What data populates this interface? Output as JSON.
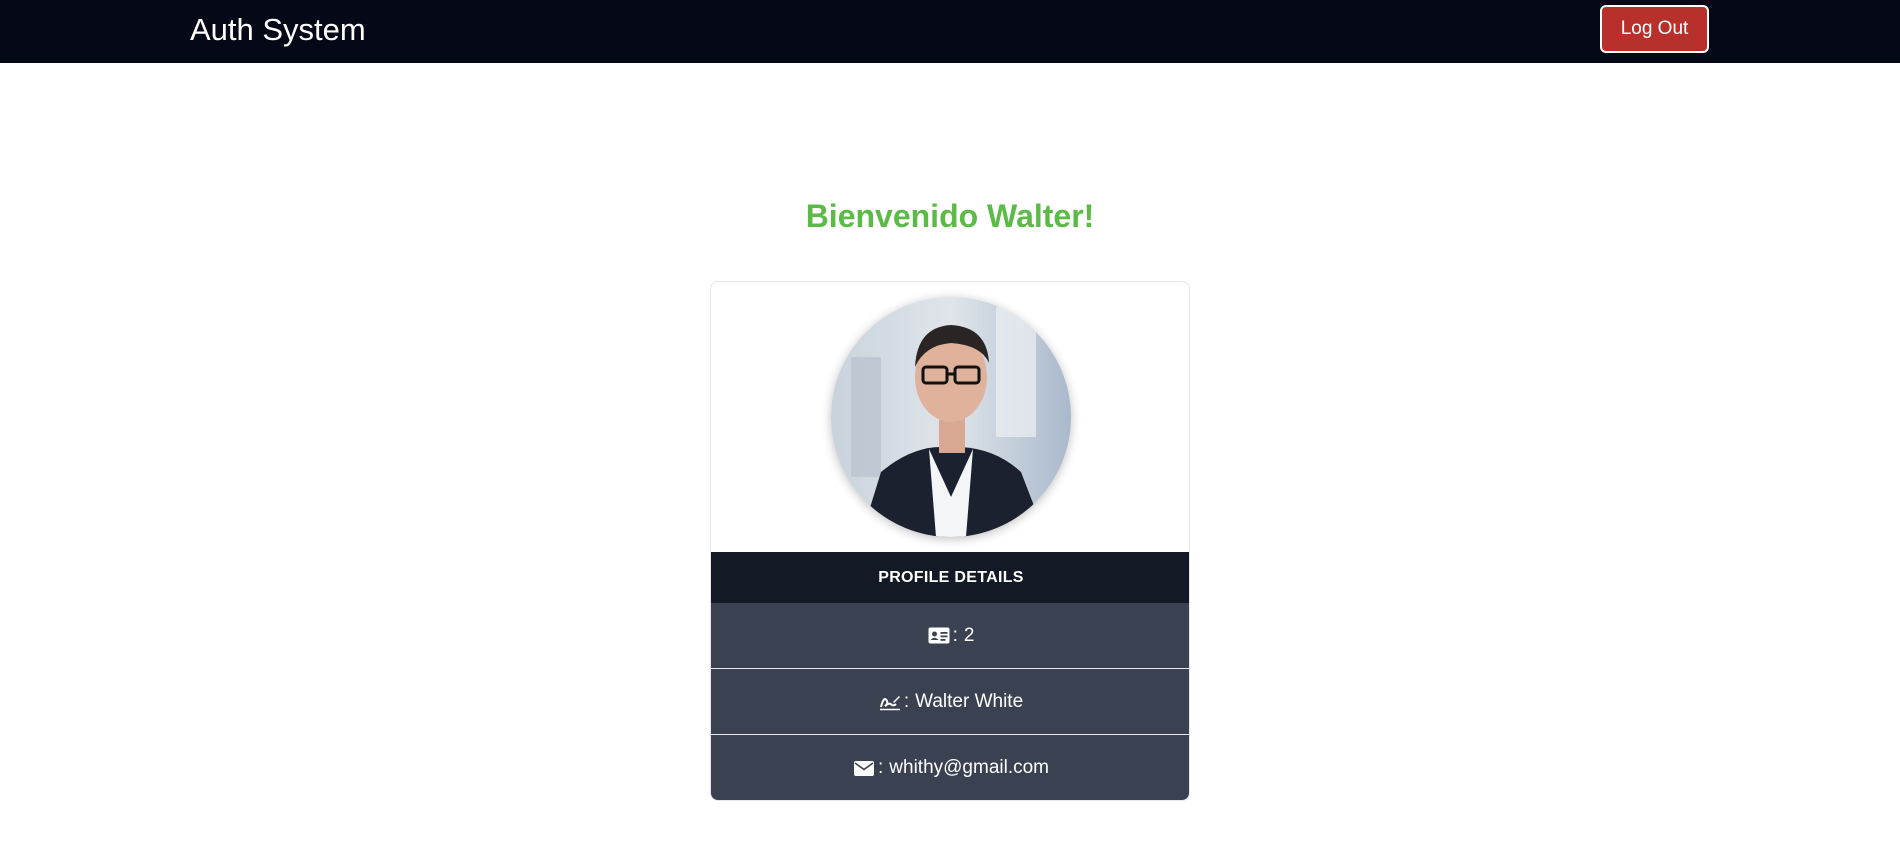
{
  "navbar": {
    "brand": "Auth System",
    "logout_label": "Log Out"
  },
  "main": {
    "welcome": "Bienvenido Walter!"
  },
  "profile": {
    "avatar_icon": "user-photo",
    "details_header": "PROFILE DETAILS",
    "separator": ":",
    "rows": [
      {
        "icon": "id-card-icon",
        "value": "2"
      },
      {
        "icon": "signature-icon",
        "value": "Walter White"
      },
      {
        "icon": "envelope-icon",
        "value": "whithy@gmail.com"
      }
    ]
  },
  "colors": {
    "navbar_bg": "#050816",
    "logout_bg": "#b8302b",
    "welcome_text": "#5cba47",
    "details_header_bg": "#141a25",
    "detail_row_bg": "#3a4150"
  }
}
